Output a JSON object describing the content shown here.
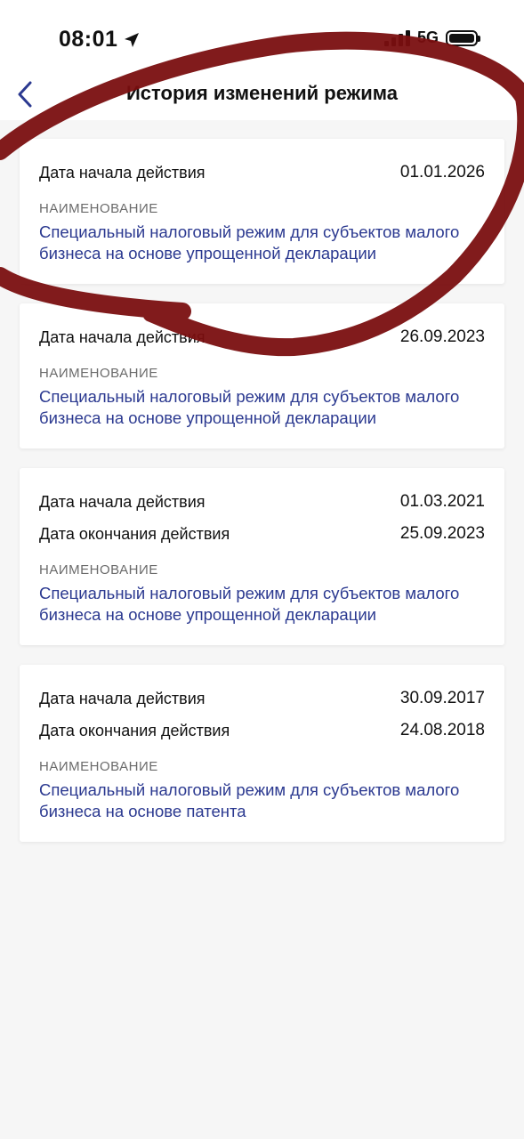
{
  "status_bar": {
    "time": "08:01",
    "network": "5G",
    "location_icon": "location-arrow-icon",
    "signal_icon": "signal-bars-icon",
    "battery_icon": "battery-icon"
  },
  "header": {
    "title": "История изменений режима",
    "back_icon": "chevron-left-icon"
  },
  "colors": {
    "accent": "#2b3990",
    "marker": "#7a0f10",
    "background": "#f6f6f6"
  },
  "records": [
    {
      "start_label": "Дата начала действия",
      "start_date": "01.01.2026",
      "section_label": "НАИМЕНОВАНИЕ",
      "name": "Специальный налоговый режим для субъектов малого бизнеса на основе упрощенной декларации"
    },
    {
      "start_label": "Дата начала действия",
      "start_date": "26.09.2023",
      "section_label": "НАИМЕНОВАНИЕ",
      "name": "Специальный налоговый режим для субъектов малого бизнеса на основе упрощенной декларации"
    },
    {
      "start_label": "Дата начала действия",
      "start_date": "01.03.2021",
      "end_label": "Дата окончания действия",
      "end_date": "25.09.2023",
      "section_label": "НАИМЕНОВАНИЕ",
      "name": "Специальный налоговый режим для субъектов малого бизнеса на основе упрощенной декларации"
    },
    {
      "start_label": "Дата начала действия",
      "start_date": "30.09.2017",
      "end_label": "Дата окончания действия",
      "end_date": "24.08.2018",
      "section_label": "НАИМЕНОВАНИЕ",
      "name": "Специальный налоговый режим для субъектов малого бизнеса на основе патента"
    }
  ]
}
